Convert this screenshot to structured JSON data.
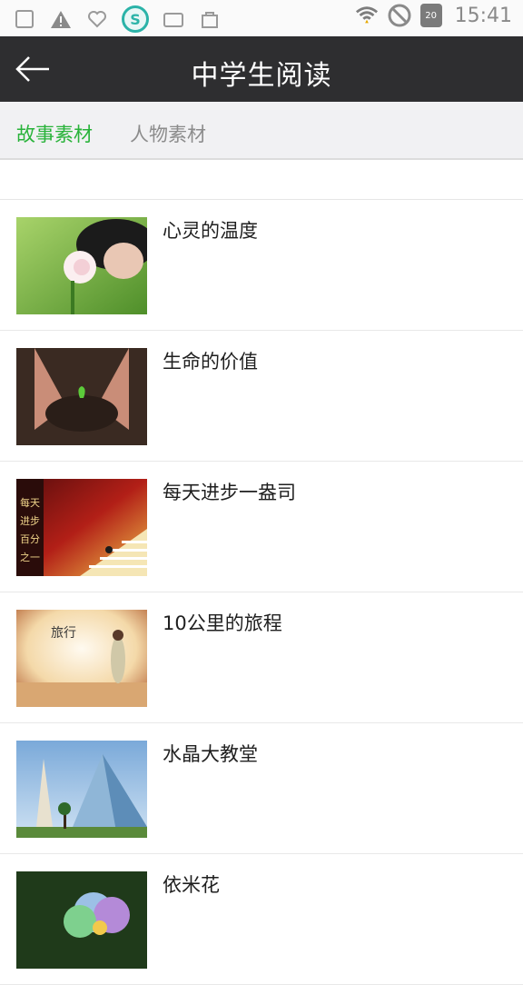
{
  "status_bar": {
    "time": "15:41",
    "icons": [
      "image-icon",
      "warning-icon",
      "heart-icon",
      "security-shield-icon",
      "folder-icon",
      "bag-icon",
      "wifi-icon",
      "no-disturb-icon",
      "android-update-icon"
    ],
    "badge": "20"
  },
  "header": {
    "title": "中学生阅读",
    "back_icon": "arrow-left-icon"
  },
  "tabs": [
    {
      "label": "故事素材",
      "active": true
    },
    {
      "label": "人物素材",
      "active": false
    }
  ],
  "items": [
    {
      "title": "心灵的温度",
      "thumb": "flower-girl"
    },
    {
      "title": "生命的价值",
      "thumb": "hands-soil"
    },
    {
      "title": "每天进步一盎司",
      "thumb": "stairs-runner"
    },
    {
      "title": "10公里的旅程",
      "thumb": "woman-beach"
    },
    {
      "title": "水晶大教堂",
      "thumb": "glass-cathedral"
    },
    {
      "title": "依米花",
      "thumb": "cosmos-flower"
    }
  ],
  "thumb_texts": {
    "stairs_caption": "每天进步百分之一",
    "beach_caption": "旅行"
  },
  "colors": {
    "header_bg": "#2e2e30",
    "accent": "#29b33a",
    "tab_bg": "#f1f1f3",
    "inactive_tab": "#8c8c8c"
  }
}
